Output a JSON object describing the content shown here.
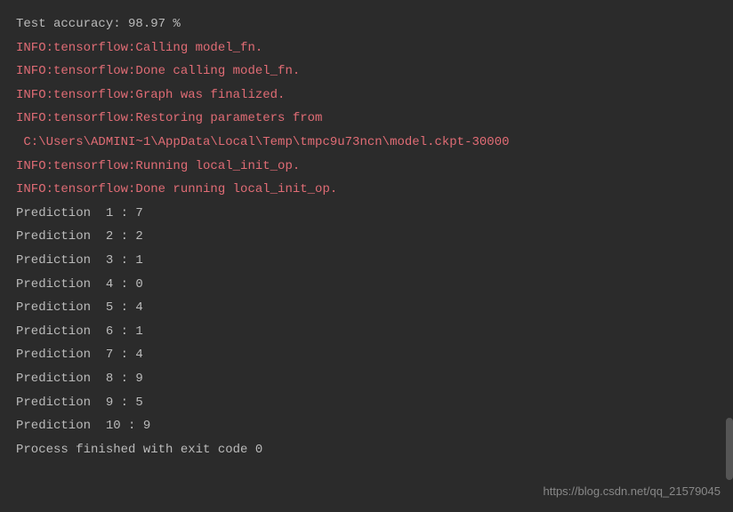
{
  "lines": [
    {
      "text": "Test accuracy: 98.97 %",
      "class": "white-text"
    },
    {
      "text": "INFO:tensorflow:Calling model_fn.",
      "class": "red-text"
    },
    {
      "text": "INFO:tensorflow:Done calling model_fn.",
      "class": "red-text"
    },
    {
      "text": "INFO:tensorflow:Graph was finalized.",
      "class": "red-text"
    },
    {
      "text": "INFO:tensorflow:Restoring parameters from",
      "class": "red-text"
    },
    {
      "text": " C:\\Users\\ADMINI~1\\AppData\\Local\\Temp\\tmpc9u73ncn\\model.ckpt-30000",
      "class": "red-text"
    },
    {
      "text": "INFO:tensorflow:Running local_init_op.",
      "class": "red-text"
    },
    {
      "text": "INFO:tensorflow:Done running local_init_op.",
      "class": "red-text"
    },
    {
      "text": "Prediction  1 : 7",
      "class": "white-text"
    },
    {
      "text": "Prediction  2 : 2",
      "class": "white-text"
    },
    {
      "text": "Prediction  3 : 1",
      "class": "white-text"
    },
    {
      "text": "Prediction  4 : 0",
      "class": "white-text"
    },
    {
      "text": "Prediction  5 : 4",
      "class": "white-text"
    },
    {
      "text": "Prediction  6 : 1",
      "class": "white-text"
    },
    {
      "text": "Prediction  7 : 4",
      "class": "white-text"
    },
    {
      "text": "Prediction  8 : 9",
      "class": "white-text"
    },
    {
      "text": "Prediction  9 : 5",
      "class": "white-text"
    },
    {
      "text": "Prediction  10 : 9",
      "class": "white-text"
    },
    {
      "text": "",
      "class": "white-text"
    },
    {
      "text": "Process finished with exit code 0",
      "class": "white-text"
    }
  ],
  "watermark": "https://blog.csdn.net/qq_21579045"
}
